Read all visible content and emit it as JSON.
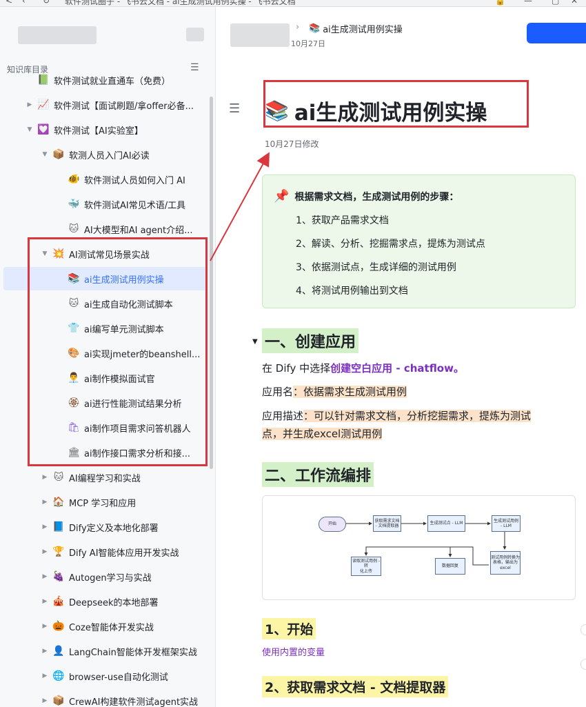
{
  "browser": {
    "tab_title": "软件测试圈子 - 飞书云文档 - ai生成测试用例实操 - 飞书云文档"
  },
  "sidebar": {
    "caption": "知识库目录",
    "items": [
      {
        "label": "软件测试就业直通车（免费）",
        "emoji": "📗",
        "color": "#4caf50",
        "level": 1,
        "arrow": ""
      },
      {
        "label": "软件测试【面试刷题/拿offer必备...",
        "emoji": "📈",
        "color": "#e27ad2",
        "level": 1,
        "arrow": "▶"
      },
      {
        "label": "软件测试【AI实验室】",
        "emoji": "💟",
        "color": "#e27ad2",
        "level": 1,
        "arrow": "▼"
      },
      {
        "label": "软测人员入门AI必读",
        "emoji": "📦",
        "color": "#c98b4b",
        "level": 2,
        "arrow": "▼"
      },
      {
        "label": "软件测试人员如何入门 AI",
        "emoji": "🐠",
        "color": "#f08c3b",
        "level": 3,
        "arrow": ""
      },
      {
        "label": "软件测试AI常见术语/工具",
        "emoji": "🐳",
        "color": "#3aa0e8",
        "level": 3,
        "arrow": ""
      },
      {
        "label": "AI大模型和AI agent介绍...",
        "emoji": "🐱",
        "color": "#6b6b6b",
        "level": 3,
        "arrow": ""
      },
      {
        "label": "AI测试常见场景实战",
        "emoji": "💥",
        "color": "#e8553a",
        "level": 2,
        "arrow": "▼"
      },
      {
        "label": "ai生成测试用例实操",
        "emoji": "📚",
        "color": "#4caf50",
        "level": 3,
        "arrow": "",
        "active": true
      },
      {
        "label": "ai生成自动化测试脚本",
        "emoji": "🐱",
        "color": "#6b6b6b",
        "level": 3,
        "arrow": ""
      },
      {
        "label": "ai编写单元测试脚本",
        "emoji": "👕",
        "color": "#d9363e",
        "level": 3,
        "arrow": ""
      },
      {
        "label": "ai实现jmeter的beanshell...",
        "emoji": "🎨",
        "color": "#f0b429",
        "level": 3,
        "arrow": ""
      },
      {
        "label": "ai制作模拟面试官",
        "emoji": "👨‍💼",
        "color": "#c98b4b",
        "level": 3,
        "arrow": ""
      },
      {
        "label": "ai进行性能测试结果分析",
        "emoji": "🏵",
        "color": "#8a5a3b",
        "level": 3,
        "arrow": ""
      },
      {
        "label": "ai制作项目需求问答机器人",
        "emoji": "🛍",
        "color": "#8e6bd8",
        "level": 3,
        "arrow": ""
      },
      {
        "label": "ai制作接口需求分析和接...",
        "emoji": "🏛",
        "color": "#6b6b6b",
        "level": 3,
        "arrow": ""
      },
      {
        "label": "AI编程学习和实战",
        "emoji": "🐱",
        "color": "#6b6b6b",
        "level": 2,
        "arrow": "▶"
      },
      {
        "label": "MCP 学习和应用",
        "emoji": "🏠",
        "color": "#d9363e",
        "level": 2,
        "arrow": "▶"
      },
      {
        "label": "Dify定义及本地化部署",
        "emoji": "📘",
        "color": "#2e8b8b",
        "level": 2,
        "arrow": "▶"
      },
      {
        "label": "Dify AI智能体应用开发实战",
        "emoji": "🏆",
        "color": "#e0a020",
        "level": 2,
        "arrow": "▶"
      },
      {
        "label": "Autogen学习与实战",
        "emoji": "🍇",
        "color": "#7b2fbe",
        "level": 2,
        "arrow": "▶"
      },
      {
        "label": "Deepseek的本地部署",
        "emoji": "🎪",
        "color": "#d9363e",
        "level": 2,
        "arrow": "▶"
      },
      {
        "label": "Coze智能体开发实战",
        "emoji": "🎃",
        "color": "#e8553a",
        "level": 2,
        "arrow": "▶"
      },
      {
        "label": "LangChain智能体开发框架实战",
        "emoji": "👤",
        "color": "#4caf50",
        "level": 2,
        "arrow": "▶"
      },
      {
        "label": "browser-use自动化测试",
        "emoji": "🌐",
        "color": "#3aa0e8",
        "level": 2,
        "arrow": "▶"
      },
      {
        "label": "CrewAI构建软件测试agent实战",
        "emoji": "📦",
        "color": "#c98b4b",
        "level": 2,
        "arrow": "▶"
      }
    ]
  },
  "header": {
    "breadcrumb_current": "ai生成测试用例实操",
    "breadcrumb_sub": "10月27日"
  },
  "doc": {
    "title": "ai生成测试用例实操",
    "modified": "10月27日修改",
    "callout": {
      "heading": "根据需求文档，生成测试用例的步骤：",
      "steps": [
        "1、获取产品需求文档",
        "2、解读、分析、挖掘需求点，提炼为测试点",
        "3、依据测试点，生成详细的测试用例",
        "4、将测试用例输出到文档"
      ]
    },
    "section1": {
      "heading": "一、创建应用",
      "p1_prefix": "在 Dify 中选择",
      "p1_link": "创建空白应用 - chatflow。",
      "p2_label": "应用名",
      "p2_value": "：依据需求生成测试用例",
      "p3_label": "应用描述",
      "p3_value_line1": "：可以针对需求文档，分析挖掘需求，提炼为测试",
      "p3_value_line2": "点，并生成excel测试用例"
    },
    "section2": {
      "heading": "二、工作流编排",
      "nodes": [
        "开始",
        "获取需求文档\n- 文档提取器",
        "生成测试点 - LLM",
        "生成测试用例 - LLM",
        "测试用例转换为\n表格，输出为excel",
        "数据回复",
        "读取测试用例 - 转\n化上传"
      ]
    },
    "sub1": {
      "heading": "1、开始",
      "link": "使用内置的变量"
    },
    "sub2": {
      "heading": "2、获取需求文档 - 文档提取器"
    }
  }
}
